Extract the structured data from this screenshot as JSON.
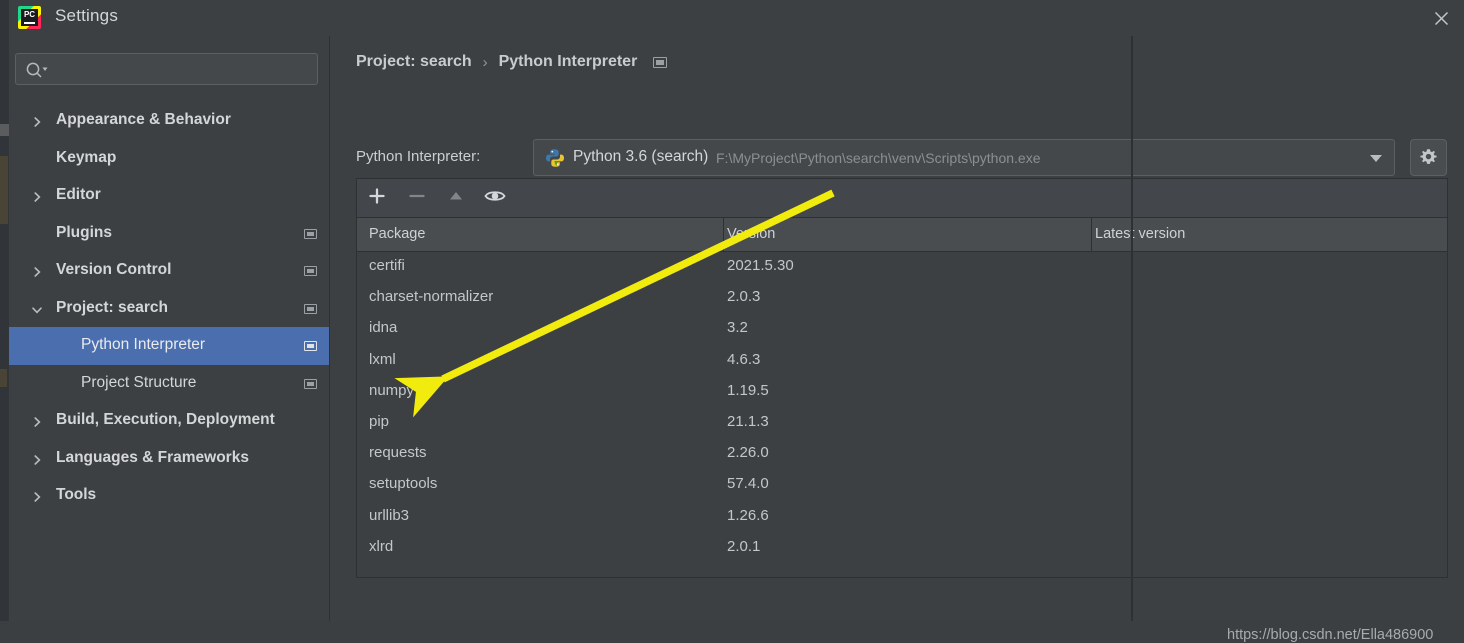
{
  "window": {
    "title": "Settings",
    "app_icon": "pycharm-logo-icon",
    "logo_text": "PC",
    "close_icon": "close-icon"
  },
  "search": {
    "value": "",
    "placeholder": "",
    "icon": "search-icon"
  },
  "sidebar": {
    "items": [
      {
        "label": "Appearance & Behavior",
        "level": 0,
        "chevron": "chevron-right-icon",
        "bold": true,
        "badge": false,
        "selected": false
      },
      {
        "label": "Keymap",
        "level": 0,
        "chevron": "",
        "bold": true,
        "badge": false,
        "selected": false
      },
      {
        "label": "Editor",
        "level": 0,
        "chevron": "chevron-right-icon",
        "bold": true,
        "badge": false,
        "selected": false
      },
      {
        "label": "Plugins",
        "level": 0,
        "chevron": "",
        "bold": true,
        "badge": true,
        "selected": false
      },
      {
        "label": "Version Control",
        "level": 0,
        "chevron": "chevron-right-icon",
        "bold": true,
        "badge": true,
        "selected": false
      },
      {
        "label": "Project: search",
        "level": 0,
        "chevron": "chevron-down-icon",
        "bold": true,
        "badge": true,
        "selected": false
      },
      {
        "label": "Python Interpreter",
        "level": 1,
        "chevron": "",
        "bold": false,
        "badge": true,
        "selected": true
      },
      {
        "label": "Project Structure",
        "level": 1,
        "chevron": "",
        "bold": false,
        "badge": true,
        "selected": false
      },
      {
        "label": "Build, Execution, Deployment",
        "level": 0,
        "chevron": "chevron-right-icon",
        "bold": true,
        "badge": false,
        "selected": false
      },
      {
        "label": "Languages & Frameworks",
        "level": 0,
        "chevron": "chevron-right-icon",
        "bold": true,
        "badge": false,
        "selected": false
      },
      {
        "label": "Tools",
        "level": 0,
        "chevron": "chevron-right-icon",
        "bold": true,
        "badge": false,
        "selected": false
      }
    ]
  },
  "main": {
    "breadcrumb": {
      "parent": "Project: search",
      "separator": "›",
      "current": "Python Interpreter",
      "badge_icon": "window-badge-icon"
    },
    "interpreter": {
      "label": "Python Interpreter:",
      "icon": "python-venv-icon",
      "name": "Python 3.6 (search)",
      "path": "F:\\MyProject\\Python\\search\\venv\\Scripts\\python.exe",
      "dropdown_icon": "chevron-down-icon",
      "settings_icon": "gear-icon"
    },
    "toolbar": [
      {
        "name": "add-package-button",
        "icon": "plus-icon",
        "enabled": true
      },
      {
        "name": "remove-package-button",
        "icon": "minus-icon",
        "enabled": false
      },
      {
        "name": "upgrade-package-button",
        "icon": "up-arrow-icon",
        "enabled": false
      },
      {
        "name": "show-early-releases-button",
        "icon": "eye-icon",
        "enabled": true
      }
    ],
    "table": {
      "columns": [
        "Package",
        "Version",
        "Latest version"
      ],
      "rows": [
        {
          "package": "certifi",
          "version": "2021.5.30",
          "latest": ""
        },
        {
          "package": "charset-normalizer",
          "version": "2.0.3",
          "latest": ""
        },
        {
          "package": "idna",
          "version": "3.2",
          "latest": ""
        },
        {
          "package": "lxml",
          "version": "4.6.3",
          "latest": ""
        },
        {
          "package": "numpy",
          "version": "1.19.5",
          "latest": ""
        },
        {
          "package": "pip",
          "version": "21.1.3",
          "latest": ""
        },
        {
          "package": "requests",
          "version": "2.26.0",
          "latest": ""
        },
        {
          "package": "setuptools",
          "version": "57.4.0",
          "latest": ""
        },
        {
          "package": "urllib3",
          "version": "1.26.6",
          "latest": ""
        },
        {
          "package": "xlrd",
          "version": "2.0.1",
          "latest": ""
        }
      ]
    },
    "watermark": "https://blog.csdn.net/Ella486900"
  },
  "annotation": {
    "arrow_color": "#f2ec0e",
    "points_to": "numpy"
  },
  "colors": {
    "dialog_bg": "#3c4043",
    "selection": "#4b6eaf",
    "text": "#d4d6d7",
    "muted_text": "#8b8f93",
    "border": "#2e3134",
    "header_bg": "#4a4d50"
  }
}
